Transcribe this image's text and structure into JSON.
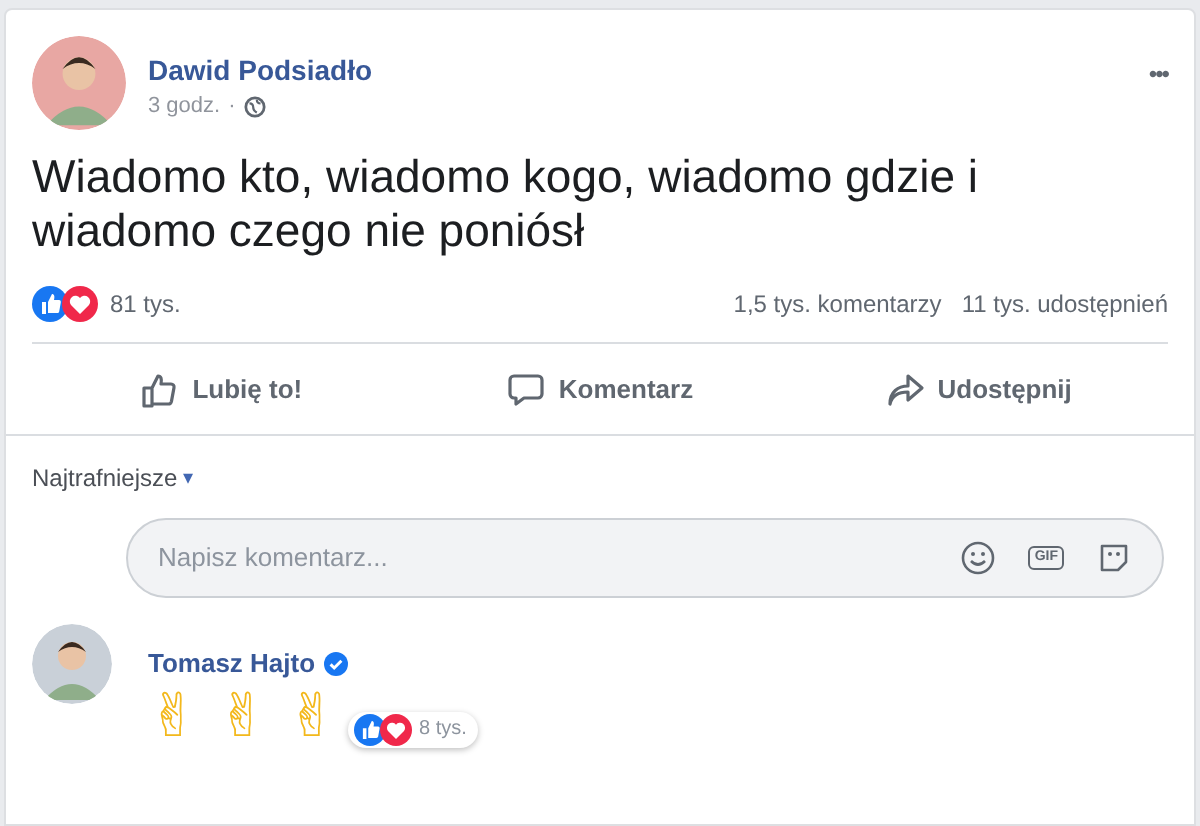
{
  "post": {
    "author": "Dawid Podsiadło",
    "time": "3 godz.",
    "separator": "·",
    "more": "•••",
    "text": "Wiadomo kto, wiadomo kogo, wiadomo gdzie i wiadomo czego nie poniósł",
    "reactions_count": "81 tys.",
    "comments_count": "1,5 tys. komentarzy",
    "shares_count": "11 tys. udostępnień"
  },
  "actions": [
    {
      "kind": "like",
      "label": "Lubię to!"
    },
    {
      "kind": "comment",
      "label": "Komentarz"
    },
    {
      "kind": "share",
      "label": "Udostępnij"
    }
  ],
  "sort": {
    "label": "Najtrafniejsze",
    "caret": "▾"
  },
  "comment_field": {
    "placeholder": "Napisz komentarz...",
    "gif": "GIF"
  },
  "comments": [
    {
      "author": "Tomasz Hajto",
      "verified": true,
      "text": "✌ ✌ ✌",
      "reactions_count": "8 tys."
    }
  ]
}
